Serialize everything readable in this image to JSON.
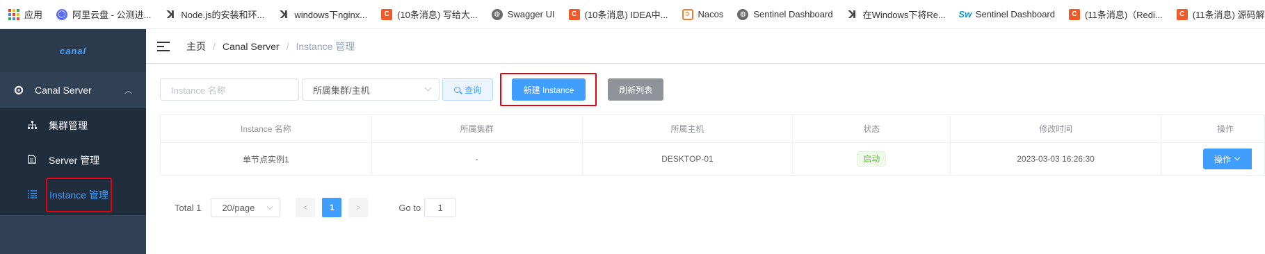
{
  "bookmarks": [
    {
      "icon": "apps-icon",
      "label": "应用"
    },
    {
      "icon": "aliyun-drive-icon",
      "label": "阿里云盘 - 公测进..."
    },
    {
      "icon": "yuque-icon",
      "label": "Node.js的安装和环..."
    },
    {
      "icon": "yuque-icon",
      "label": "windows下nginx..."
    },
    {
      "icon": "csdn-icon",
      "label": "(10条消息) 写给大..."
    },
    {
      "icon": "globe-icon",
      "label": "Swagger UI"
    },
    {
      "icon": "csdn-icon",
      "label": "(10条消息) IDEA中..."
    },
    {
      "icon": "nacos-icon",
      "label": "Nacos"
    },
    {
      "icon": "globe-icon",
      "label": "Sentinel Dashboard"
    },
    {
      "icon": "yuque-icon",
      "label": "在Windows下将Re..."
    },
    {
      "icon": "sw-icon",
      "label": "Sentinel Dashboard"
    },
    {
      "icon": "csdn-icon",
      "label": "(11条消息)（Redi..."
    },
    {
      "icon": "csdn-icon",
      "label": "(11条消息) 源码解..."
    }
  ],
  "sidebar": {
    "logo": "canal",
    "group": "Canal Server",
    "items": [
      {
        "label": "集群管理",
        "icon": "cluster-icon"
      },
      {
        "label": "Server 管理",
        "icon": "server-icon"
      },
      {
        "label": "Instance 管理",
        "icon": "list-icon",
        "active": true
      }
    ]
  },
  "breadcrumb": [
    "主页",
    "Canal Server",
    "Instance 管理"
  ],
  "filters": {
    "name_placeholder": "Instance 名称",
    "cluster_select": "所属集群/主机",
    "query_label": "查询",
    "new_label": "新建 Instance",
    "refresh_label": "刷新列表"
  },
  "table": {
    "columns": [
      "Instance 名称",
      "所属集群",
      "所属主机",
      "状态",
      "修改时间",
      "操作"
    ],
    "rows": [
      {
        "name": "单节点实例1",
        "cluster": "-",
        "host": "DESKTOP-01",
        "status": "启动",
        "modified": "2023-03-03 16:26:30",
        "action": "操作"
      }
    ]
  },
  "pagination": {
    "total": "Total 1",
    "page_size": "20/page",
    "current_page": "1",
    "goto_label": "Go to",
    "goto_value": "1"
  },
  "colors": {
    "sidebar_bg": "#304156",
    "primary": "#409eff",
    "highlight_box": "#e60012",
    "status_green": "#67c23a"
  }
}
